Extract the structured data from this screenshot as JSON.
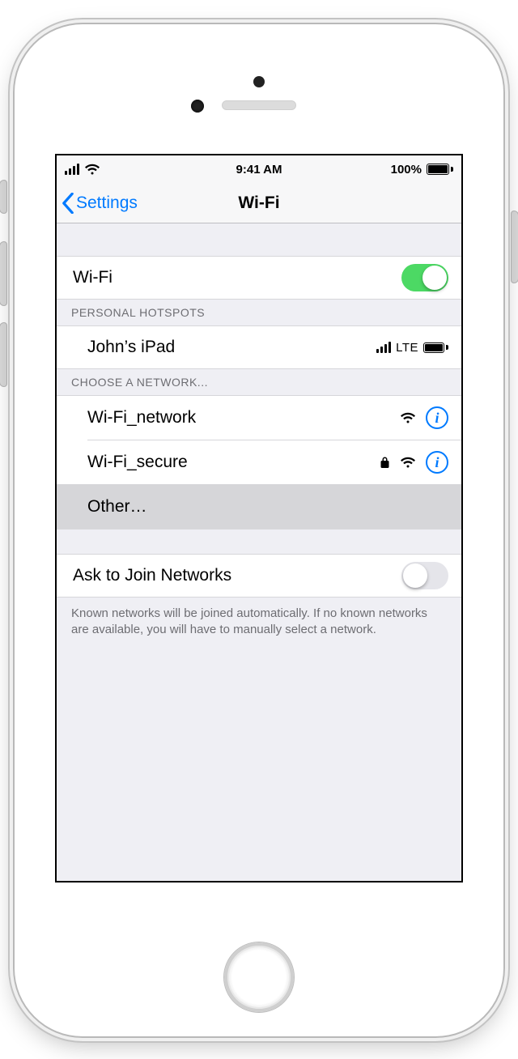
{
  "status_bar": {
    "time": "9:41 AM",
    "battery_pct": "100%"
  },
  "nav": {
    "back_label": "Settings",
    "title": "Wi-Fi"
  },
  "wifi_toggle": {
    "label": "Wi-Fi",
    "on": true
  },
  "sections": {
    "hotspots_header": "Personal Hotspots",
    "networks_header": "Choose a Network..."
  },
  "hotspot": {
    "name": "John’s iPad",
    "conn_type": "LTE"
  },
  "networks": [
    {
      "name": "Wi-Fi_network",
      "locked": false
    },
    {
      "name": "Wi-Fi_secure",
      "locked": true
    }
  ],
  "other_label": "Other…",
  "ask_join": {
    "label": "Ask to Join Networks",
    "on": false
  },
  "footer_note": "Known networks will be joined automatically. If no known networks are available, you will have to manually select a network."
}
